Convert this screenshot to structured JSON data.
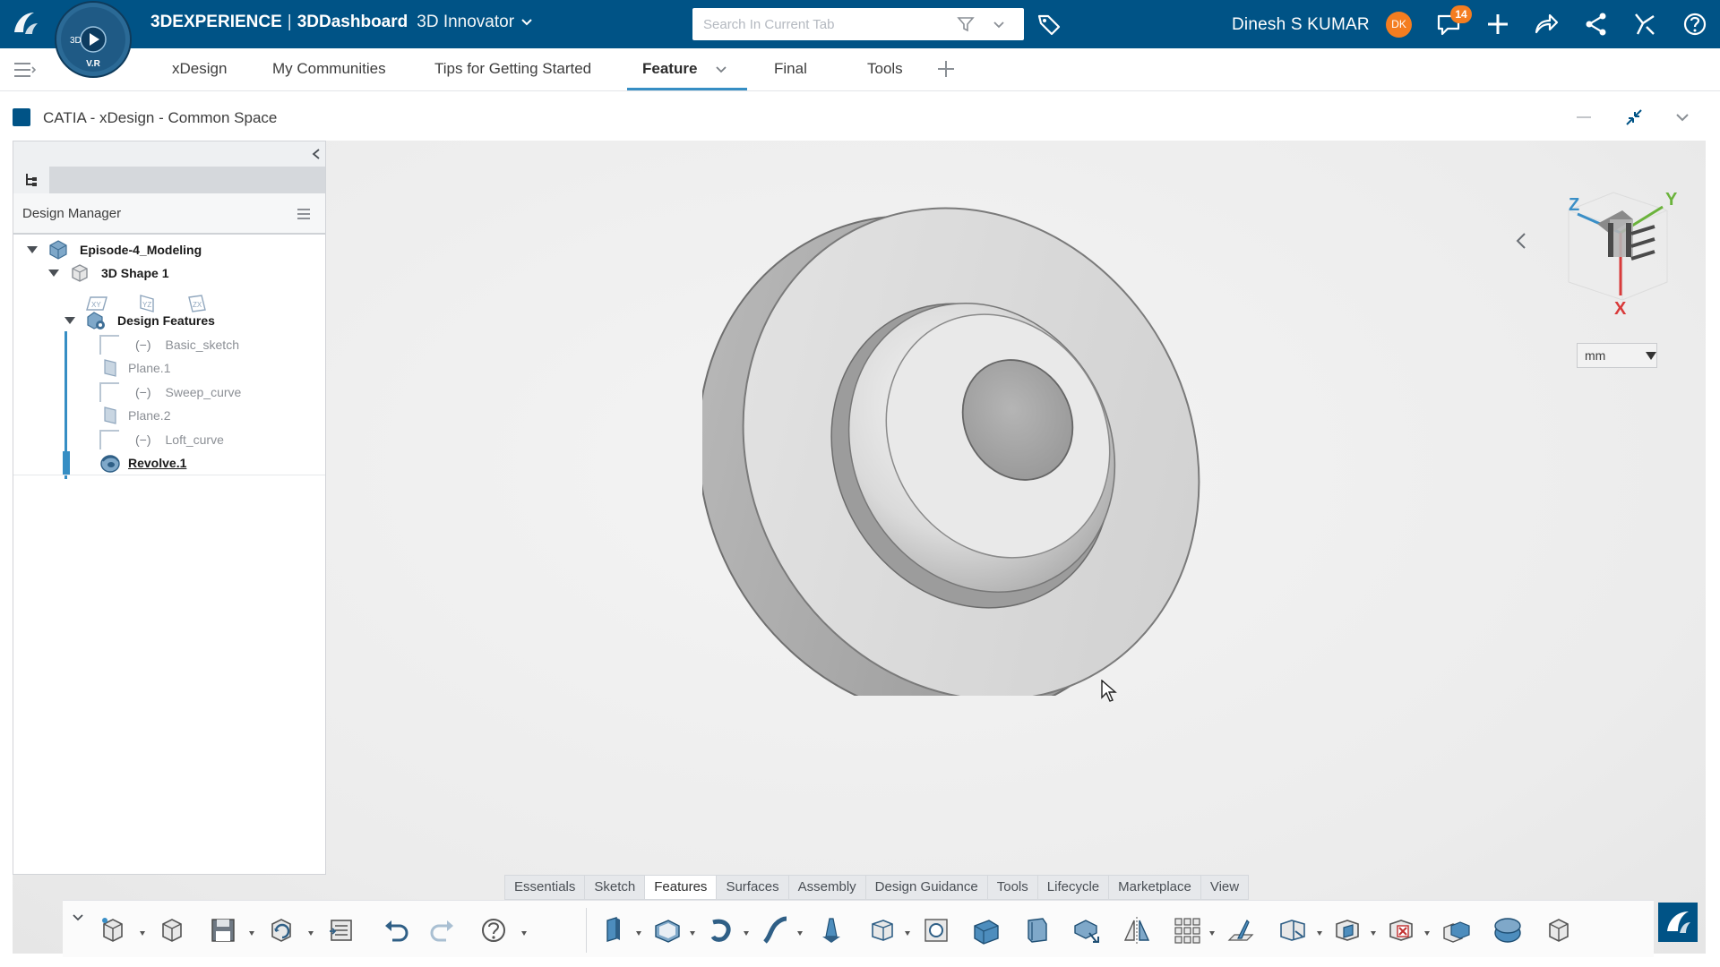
{
  "topbar": {
    "compass_label": "V.R",
    "compass_3d": "3D",
    "product": "3DEXPERIENCE",
    "separator": "|",
    "dashboard": "3DDashboard",
    "role": "3D Innovator",
    "search_placeholder": "Search In Current Tab",
    "user_name": "Dinesh S KUMAR",
    "user_initials": "DK",
    "notification_count": "14",
    "brand_color": "#005386",
    "accent_color": "#f47d20"
  },
  "tabs": {
    "items": [
      {
        "label": "xDesign"
      },
      {
        "label": "My Communities"
      },
      {
        "label": "Tips for Getting Started"
      },
      {
        "label": "Feature"
      },
      {
        "label": "Final"
      },
      {
        "label": "Tools"
      }
    ],
    "active": "Feature",
    "active_color": "#368ec4"
  },
  "widget": {
    "title": "CATIA - xDesign - Common Space"
  },
  "design_manager": {
    "title": "Design Manager",
    "tree": {
      "root": "Episode-4_Modeling",
      "shape": "3D Shape 1",
      "planes": [
        "XY",
        "YZ",
        "ZX"
      ],
      "group": "Design Features",
      "features": [
        {
          "label": "Basic_sketch",
          "type": "sketch",
          "state": "hidden"
        },
        {
          "label": "Plane.1",
          "type": "plane",
          "state": "hidden"
        },
        {
          "label": "Sweep_curve",
          "type": "sketch",
          "state": "hidden"
        },
        {
          "label": "Plane.2",
          "type": "plane",
          "state": "hidden"
        },
        {
          "label": "Loft_curve",
          "type": "sketch",
          "state": "hidden"
        },
        {
          "label": "Revolve.1",
          "type": "revolve",
          "state": "active"
        }
      ],
      "hidden_marker": "(−)"
    }
  },
  "viewport": {
    "axes": {
      "x": "X",
      "y": "Y",
      "z": "Z"
    },
    "unit": "mm",
    "unit_options": [
      "mm"
    ]
  },
  "toolbar": {
    "section_tabs": [
      "Essentials",
      "Sketch",
      "Features",
      "Surfaces",
      "Assembly",
      "Design Guidance",
      "Tools",
      "Lifecycle",
      "Marketplace",
      "View"
    ],
    "active_section": "Features",
    "tools": [
      "new-shape",
      "open-shape",
      "save",
      "refresh",
      "manage",
      "undo",
      "redo",
      "help",
      "extrude",
      "shell",
      "revolve",
      "sweep",
      "loft",
      "thicken",
      "hole",
      "fillet",
      "chamfer",
      "draft",
      "mirror",
      "pattern",
      "rib",
      "split",
      "boolean",
      "remove",
      "transform",
      "mesh",
      "convert"
    ]
  }
}
